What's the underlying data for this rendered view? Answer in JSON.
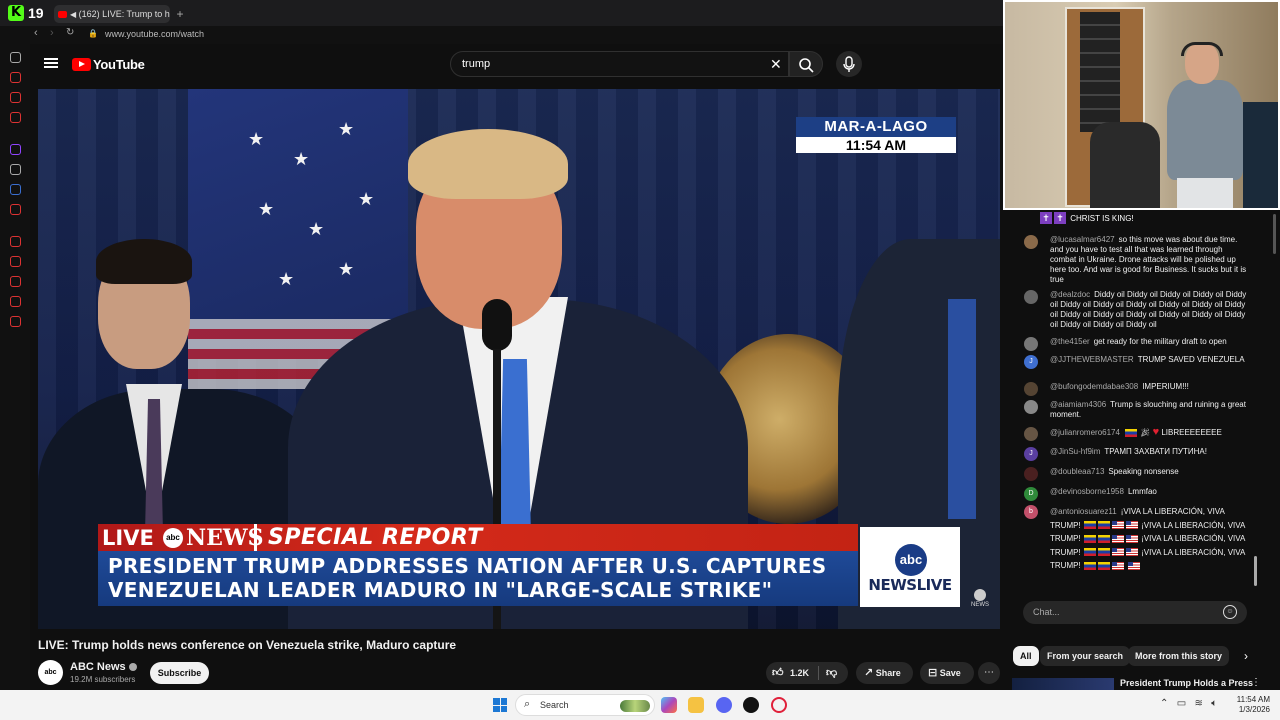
{
  "browser": {
    "brand_letter": "K",
    "brand_count": "19",
    "tab_title": "(162) LIVE: Trump to h",
    "url": "www.youtube.com/watch"
  },
  "youtube": {
    "logo_text": "YouTube",
    "search_value": "trump"
  },
  "video": {
    "bug_location": "MAR-A-LAGO",
    "bug_time": "11:54 AM",
    "lt_live": "LIVE",
    "lt_abc": "abc",
    "lt_news": "NEWS",
    "lt_special": "SPECIAL REPORT",
    "headline_1": "PRESIDENT TRUMP ADDRESSES NATION AFTER U.S. CAPTURES",
    "headline_2": "VENEZUELAN LEADER MADURO IN \"LARGE-SCALE STRIKE\"",
    "abc_logo": "abc",
    "abc_newslive": "NEWSLIVE",
    "watermark": "NEWS"
  },
  "meta": {
    "title": "LIVE: Trump holds news conference on Venezuela strike, Maduro capture",
    "channel_name": "ABC News",
    "channel_avatar": "abc",
    "subscribers": "19.2M subscribers",
    "subscribe_label": "Subscribe",
    "likes": "1.2K",
    "share_label": "Share",
    "save_label": "Save"
  },
  "chat": {
    "top_message": "CHRIST IS KING!",
    "messages": [
      {
        "user": "@lucasalmar6427",
        "text": "so this move was about due time. and you have to test all that was learned through combat in Ukraine. Drone attacks will be polished up here too. And war is good for Business. It sucks but it is true"
      },
      {
        "user": "@dealzdoc",
        "text": "Diddy oil Diddy oil Diddy oil Diddy oil Diddy oil Diddy oil Diddy oil Diddy oil Diddy oil Diddy oil Diddy oil Diddy oil Diddy oil Diddy oil Diddy oil Diddy oil Diddy oil Diddy oil Diddy oil Diddy oil"
      },
      {
        "user": "@the415er",
        "text": "get ready for the military draft to open"
      },
      {
        "user": "@JJTHEWEBMASTER",
        "text": "TRUMP SAVED VENEZUELA",
        "avatar": "J"
      },
      {
        "user": "@bufongodemdabae308",
        "text": "IMPERIUM!!!"
      },
      {
        "user": "@aiamiam4306",
        "text": "Trump is slouching and ruining a great moment."
      },
      {
        "user": "@julianromero6174",
        "text": "LIBREEEEEEEE"
      },
      {
        "user": "@JinSu-hf9im",
        "text": "ТРАМП ЗАХВАТИ ПУТИНА!",
        "avatar": "J"
      },
      {
        "user": "@doubleaa713",
        "text": "Speaking nonsense"
      },
      {
        "user": "@devinosborne1958",
        "text": "Lmmfao",
        "avatar": "D"
      },
      {
        "user": "@antoniosuarez11",
        "text_1": "¡VIVA LA LIBERACIÓN, VIVA TRUMP!",
        "text_2": "¡VIVA LA LIBERACIÓN,",
        "text_3": "VIVA TRUMP!",
        "text_4": "¡VIVA LA",
        "text_5": "LIBERACIÓN, VIVA TRUMP!",
        "text_6": "¡VIVA LA LIBERACIÓN, VIVA TRUMP!",
        "avatar": "b"
      }
    ],
    "input_placeholder": "Chat..."
  },
  "chips": [
    "All",
    "From your search",
    "More from this story"
  ],
  "recommended": {
    "title": "President Trump Holds a Press"
  },
  "taskbar": {
    "search_placeholder": "Search",
    "time": "11:54 AM",
    "date": "1/3/2026"
  }
}
